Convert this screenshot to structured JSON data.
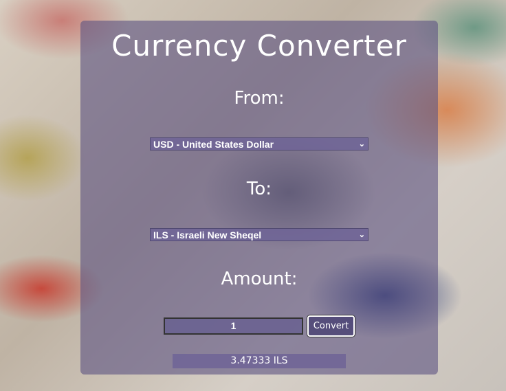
{
  "app": {
    "title": "Currency Converter"
  },
  "from": {
    "label": "From:",
    "selected": "USD - United States Dollar"
  },
  "to": {
    "label": "To:",
    "selected": "ILS - Israeli New Sheqel"
  },
  "amount": {
    "label": "Amount:",
    "value": "1"
  },
  "convert_button": {
    "label": "Convert"
  },
  "result": {
    "text": "3.47333 ILS"
  },
  "icons": {
    "dropdown": "chevron-down-icon"
  }
}
